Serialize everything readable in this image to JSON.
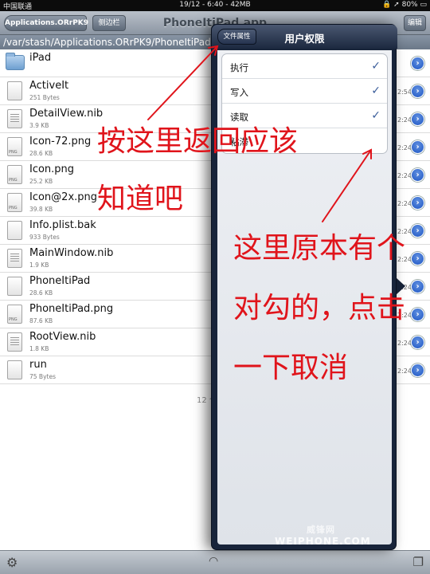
{
  "status_bar": {
    "carrier": "中国联通",
    "time": "19/12 - 6:40 - 42MB",
    "battery": "80%"
  },
  "toolbar": {
    "back_label": "Applications.ORrPK9",
    "sidebar_label": "侧边栏",
    "title": "PhoneItiPad.app",
    "edit_label": "编辑"
  },
  "path": "/var/stash/Applications.ORrPK9/PhoneItiPad.app",
  "files": [
    {
      "name": "iPad",
      "size": "",
      "time": "",
      "icon": "folder-icon"
    },
    {
      "name": "ActiveIt",
      "size": "251 Bytes",
      "time": "2:54",
      "icon": "file-icon"
    },
    {
      "name": "DetailView.nib",
      "size": "3.9 KB",
      "time": "2:24",
      "icon": "nib-file-icon"
    },
    {
      "name": "Icon-72.png",
      "size": "28.6 KB",
      "time": "2:24",
      "icon": "png-file-icon"
    },
    {
      "name": "Icon.png",
      "size": "25.2 KB",
      "time": "2:24",
      "icon": "png-file-icon"
    },
    {
      "name": "Icon@2x.png",
      "size": "39.8 KB",
      "time": "2:24",
      "icon": "png-file-icon"
    },
    {
      "name": "Info.plist.bak",
      "size": "933 Bytes",
      "time": "2:24",
      "icon": "file-icon"
    },
    {
      "name": "MainWindow.nib",
      "size": "1.9 KB",
      "time": "2:24",
      "icon": "nib-file-icon"
    },
    {
      "name": "PhoneItiPad",
      "size": "28.6 KB",
      "time": "2:24",
      "icon": "file-icon"
    },
    {
      "name": "PhoneItiPad.png",
      "size": "87.6 KB",
      "time": "2:24",
      "icon": "png-file-icon"
    },
    {
      "name": "RootView.nib",
      "size": "1.8 KB",
      "time": "2:24",
      "icon": "nib-file-icon"
    },
    {
      "name": "run",
      "size": "75 Bytes",
      "time": "2:24",
      "icon": "file-icon"
    }
  ],
  "file_count": "12 个文件",
  "popover": {
    "back_label": "文件属性",
    "title": "用户权限",
    "permissions": [
      {
        "label": "执行",
        "checked": true
      },
      {
        "label": "写入",
        "checked": true
      },
      {
        "label": "读取",
        "checked": true
      },
      {
        "label": "粘滞",
        "checked": false
      }
    ]
  },
  "annotations": {
    "left_line1": "按这里返回应该",
    "left_line2": "知道吧",
    "right_line1": "这里原本有个",
    "right_line2": "对勾的，点击",
    "right_line3": "一下取消"
  },
  "watermark": "WEIPHONE.COM",
  "watermark_cn": "威锋网",
  "colors": {
    "annotation": "#e0141b",
    "popover_frame": "#18243a",
    "disclosure": "#2a62cf",
    "checkmark": "#3b5d9a"
  }
}
